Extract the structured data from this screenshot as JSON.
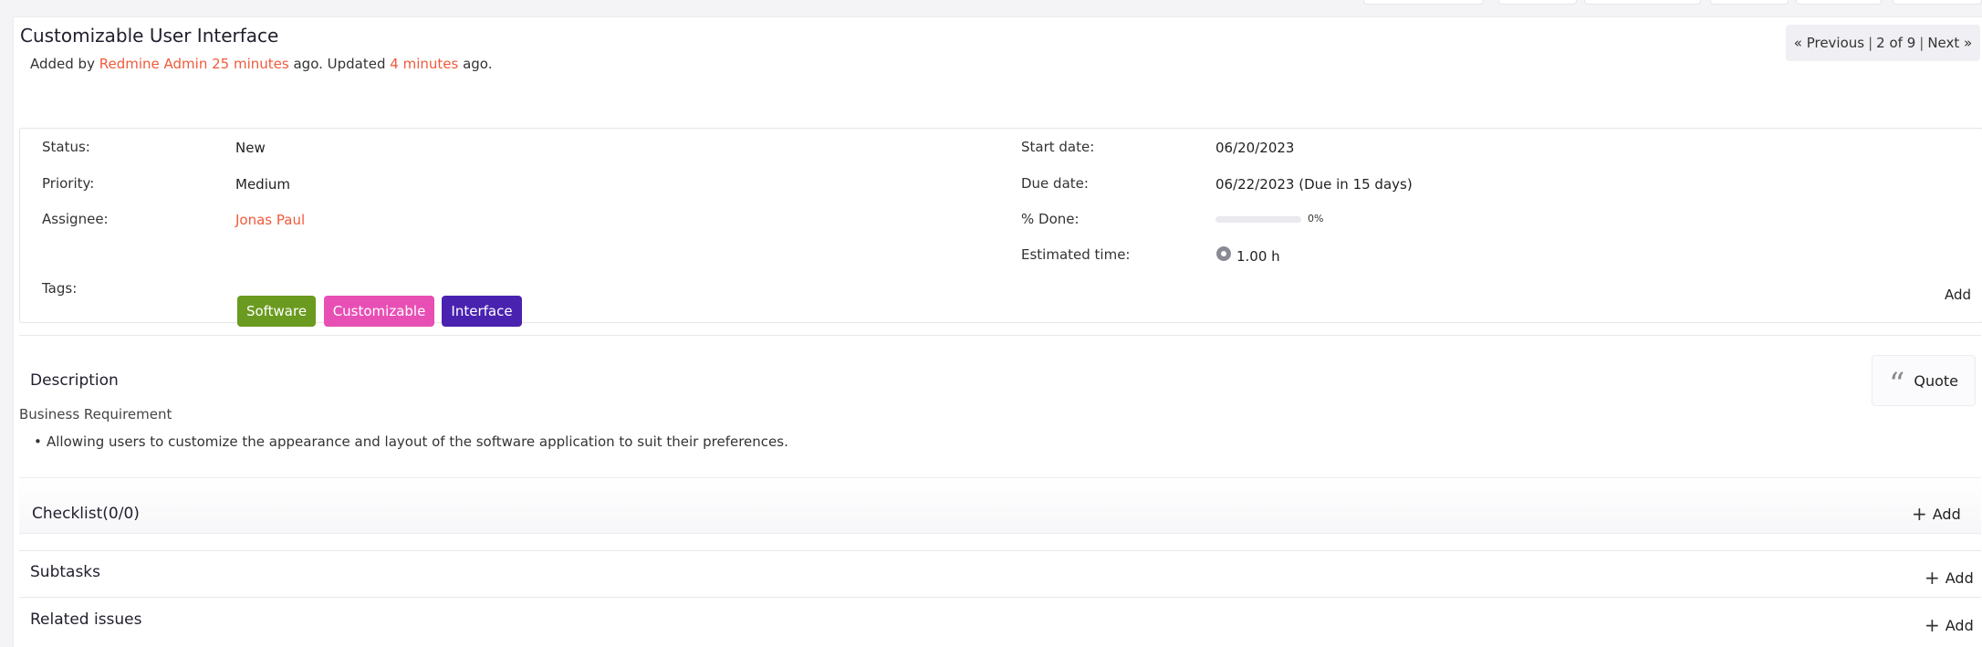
{
  "issue": {
    "title": "Customizable User Interface",
    "meta": {
      "added_by_prefix": "Added by",
      "author": "Redmine Admin",
      "added_ago": "25 minutes",
      "updated_prefix": "ago. Updated",
      "updated_ago": "4 minutes",
      "suffix": "ago."
    }
  },
  "pager": {
    "previous": "« Previous",
    "position": "2 of 9",
    "next": "Next »",
    "separator": "|"
  },
  "attributes": {
    "status_label": "Status:",
    "status_value": "New",
    "priority_label": "Priority:",
    "priority_value": "Medium",
    "assignee_label": "Assignee:",
    "assignee_value": "Jonas Paul",
    "tags_label": "Tags:",
    "start_label": "Start date:",
    "start_value": "06/20/2023",
    "due_label": "Due date:",
    "due_value": "06/22/2023 (Due in 15 days)",
    "done_label": "% Done:",
    "done_percent": 0,
    "done_text": "0%",
    "estimate_label": "Estimated time:",
    "estimate_value": "1.00 h",
    "tags_add": "Add"
  },
  "tags": [
    {
      "label": "Software",
      "color": "#6a9a1f"
    },
    {
      "label": "Customizable",
      "color": "#e84fb5"
    },
    {
      "label": "Interface",
      "color": "#4a22b0"
    }
  ],
  "description": {
    "heading": "Description",
    "quote_label": "Quote",
    "subheading": "Business Requirement",
    "bullet": "Allowing users to customize the appearance and layout of the software application to suit their preferences."
  },
  "checklist": {
    "heading": "Checklist(0/0)",
    "add": "Add"
  },
  "subtasks": {
    "heading": "Subtasks",
    "add": "Add"
  },
  "related": {
    "heading": "Related issues",
    "add": "Add"
  },
  "colors": {
    "link": "#f05a3c",
    "progress": "#4caf50"
  }
}
